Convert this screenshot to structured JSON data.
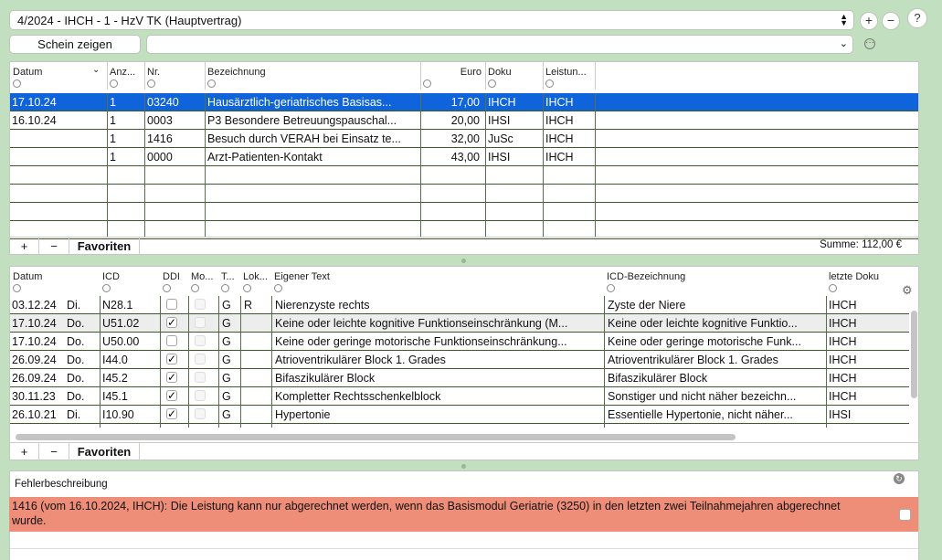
{
  "header": {
    "case_select": "4/2024 - IHCH - 1 - HzV TK (Hauptvertrag)",
    "add_label": "+",
    "remove_label": "−",
    "help_label": "?",
    "show_button": "Schein zeigen",
    "second_select": ""
  },
  "services": {
    "columns": [
      "Datum",
      "Anz...",
      "Nr.",
      "Bezeichnung",
      "Euro",
      "Doku",
      "Leistun..."
    ],
    "rows": [
      {
        "datum": "17.10.24",
        "anz": "1",
        "nr": "03240",
        "bez": "Hausärztlich-geriatrisches Basisas...",
        "euro": "17,00",
        "doku": "IHCH",
        "leist": "IHCH"
      },
      {
        "datum": "16.10.24",
        "anz": "1",
        "nr": "0003",
        "bez": "P3 Besondere Betreuungspauschal...",
        "euro": "20,00",
        "doku": "IHSI",
        "leist": "IHCH"
      },
      {
        "datum": "",
        "anz": "1",
        "nr": "1416",
        "bez": "Besuch durch VERAH bei Einsatz te...",
        "euro": "32,00",
        "doku": "JuSc",
        "leist": "IHCH"
      },
      {
        "datum": "",
        "anz": "1",
        "nr": "0000",
        "bez": "Arzt-Patienten-Kontakt",
        "euro": "43,00",
        "doku": "IHSI",
        "leist": "IHCH"
      }
    ],
    "footer_add": "+",
    "footer_remove": "−",
    "footer_fav": "Favoriten",
    "sum": "Summe: 112,00 €"
  },
  "diagnoses": {
    "columns": [
      "Datum",
      "ICD",
      "DDI",
      "Mo...",
      "T...",
      "Lok...",
      "Eigener Text",
      "ICD-Bezeichnung",
      "letzte Doku"
    ],
    "rows": [
      {
        "datum": "03.12.24",
        "day": "Di.",
        "icd": "N28.1",
        "ddi": false,
        "t": "G",
        "lok": "R",
        "text": "Nierenzyste rechts",
        "bez": "Zyste der Niere",
        "doku": "IHCH"
      },
      {
        "datum": "17.10.24",
        "day": "Do.",
        "icd": "U51.02",
        "ddi": true,
        "t": "G",
        "lok": "",
        "text": "Keine oder leichte kognitive Funktionseinschränkung (M...",
        "bez": "Keine oder leichte kognitive Funktio...",
        "doku": "IHCH"
      },
      {
        "datum": "17.10.24",
        "day": "Do.",
        "icd": "U50.00",
        "ddi": false,
        "t": "G",
        "lok": "",
        "text": "Keine oder geringe motorische Funktionseinschränkung...",
        "bez": "Keine oder geringe motorische Funk...",
        "doku": "IHCH"
      },
      {
        "datum": "26.09.24",
        "day": "Do.",
        "icd": "I44.0",
        "ddi": true,
        "t": "G",
        "lok": "",
        "text": "Atrioventrikulärer Block 1. Grades",
        "bez": "Atrioventrikulärer Block 1. Grades",
        "doku": "IHCH"
      },
      {
        "datum": "26.09.24",
        "day": "Do.",
        "icd": "I45.2",
        "ddi": true,
        "t": "G",
        "lok": "",
        "text": "Bifaszikulärer Block",
        "bez": "Bifaszikulärer Block",
        "doku": "IHCH"
      },
      {
        "datum": "30.11.23",
        "day": "Do.",
        "icd": "I45.1",
        "ddi": true,
        "t": "G",
        "lok": "",
        "text": "Kompletter Rechtsschenkelblock",
        "bez": "Sonstiger und nicht näher bezeichn...",
        "doku": "IHCH"
      },
      {
        "datum": "26.10.21",
        "day": "Di.",
        "icd": "I10.90",
        "ddi": true,
        "t": "G",
        "lok": "",
        "text": "Hypertonie",
        "bez": "Essentielle Hypertonie, nicht näher...",
        "doku": "IHSI"
      }
    ],
    "footer_add": "+",
    "footer_remove": "−",
    "footer_fav": "Favoriten"
  },
  "error": {
    "title": "Fehlerbeschreibung",
    "message": "1416 (vom 16.10.2024, IHCH): Die Leistung kann nur abgerechnet werden, wenn das Basismodul Geriatrie (3250) in den letzten zwei Teilnahmejahren abgerechnet wurde."
  },
  "colors": {
    "background": "#c2dfbf",
    "selection": "#0f64dc",
    "error": "#ee8d78"
  }
}
